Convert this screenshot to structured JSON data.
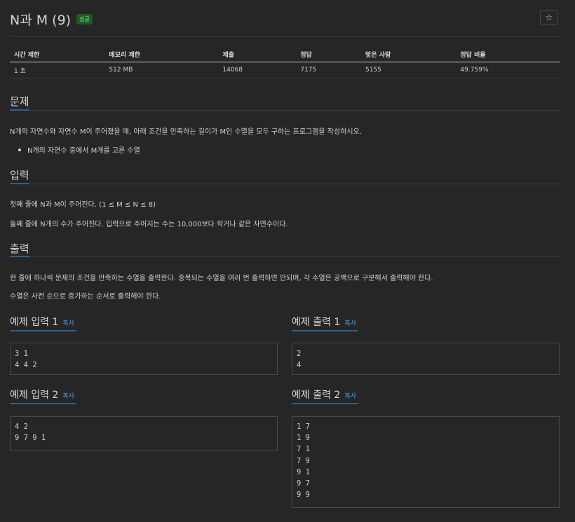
{
  "title": "N과 M (9)",
  "badge": "성공",
  "star_glyph": "☆",
  "info_table": {
    "headers": [
      "시간 제한",
      "메모리 제한",
      "제출",
      "정답",
      "맞은 사람",
      "정답 비율"
    ],
    "values": [
      "1 초",
      "512 MB",
      "14068",
      "7175",
      "5155",
      "49.759%"
    ]
  },
  "problem": {
    "heading": "문제",
    "text": "N개의 자연수와 자연수 M이 주어졌을 때, 아래 조건을 만족하는 길이가 M인 수열을 모두 구하는 프로그램을 작성하시오.",
    "bullet": "N개의 자연수 중에서 M개를 고른 수열"
  },
  "input": {
    "heading": "입력",
    "line1": "첫째 줄에 N과 M이 주어진다. (1 ≤ M ≤ N ≤ 8)",
    "line2": "둘째 줄에 N개의 수가 주어진다. 입력으로 주어지는 수는 10,000보다 작거나 같은 자연수이다."
  },
  "output": {
    "heading": "출력",
    "line1": "한 줄에 하나씩 문제의 조건을 만족하는 수열을 출력한다. 중복되는 수열을 여러 번 출력하면 안되며, 각 수열은 공백으로 구분해서 출력해야 한다.",
    "line2": "수열은 사전 순으로 증가하는 순서로 출력해야 한다."
  },
  "samples": {
    "copy_label": "복사",
    "in1_title": "예제 입력 1",
    "out1_title": "예제 출력 1",
    "in2_title": "예제 입력 2",
    "out2_title": "예제 출력 2",
    "in1": [
      "3 1",
      "4 4 2"
    ],
    "out1": [
      "2",
      "4"
    ],
    "in2": [
      "4 2",
      "9 7 9 1"
    ],
    "out2": [
      "1 7",
      "1 9",
      "7 1",
      "7 9",
      "9 1",
      "9 7",
      "9 9"
    ]
  },
  "colors": {
    "background": "#262626",
    "accent": "#4d9be0",
    "badge_bg": "#1a5c26",
    "badge_fg": "#9be59b"
  }
}
